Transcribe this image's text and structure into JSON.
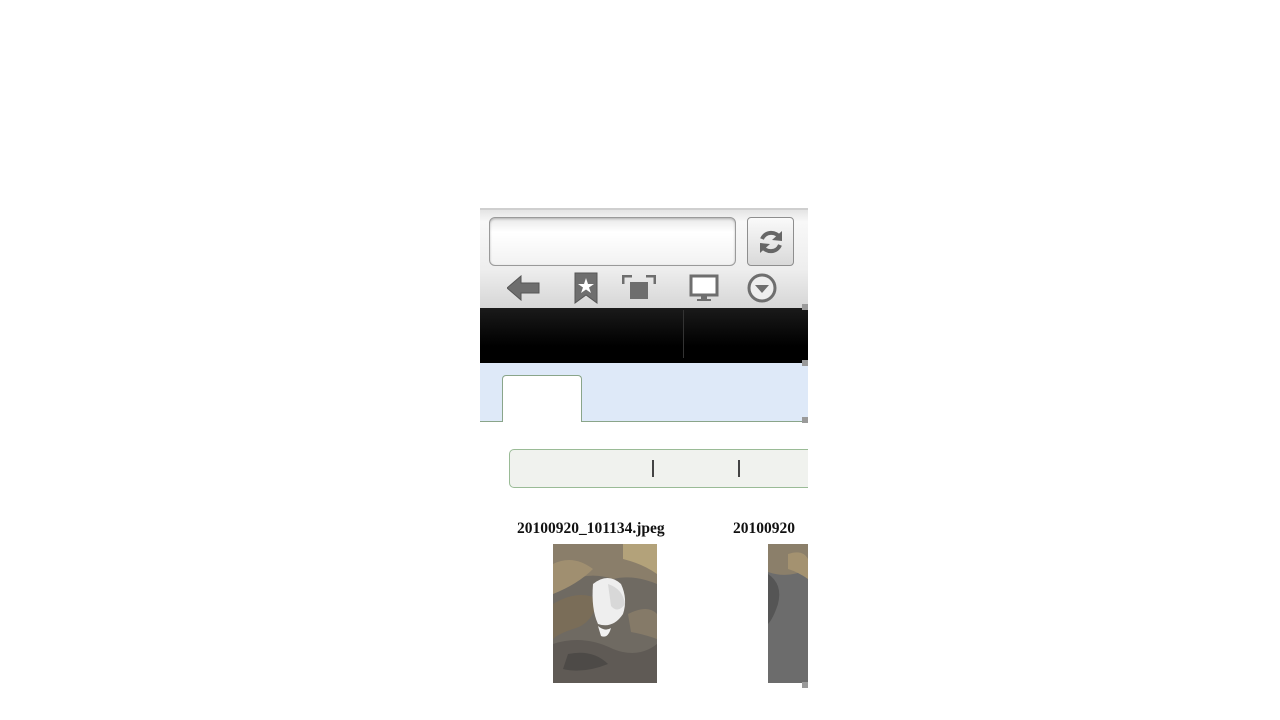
{
  "browser": {
    "url_value": "",
    "reload_icon": "reload-icon",
    "toolbar_icons": [
      "back-arrow-icon",
      "bookmark-star-icon",
      "window-switch-icon",
      "desktop-monitor-icon",
      "dropdown-circle-icon"
    ]
  },
  "tabs": {
    "active_label": ""
  },
  "files": [
    {
      "name": "20100920_101134.jpeg"
    },
    {
      "name": "20100920"
    }
  ],
  "colors": {
    "tabstrip_bg": "#dee9f8",
    "tab_border": "#8aa58a",
    "filter_border": "#9abb96",
    "black_bar": "#000000"
  }
}
